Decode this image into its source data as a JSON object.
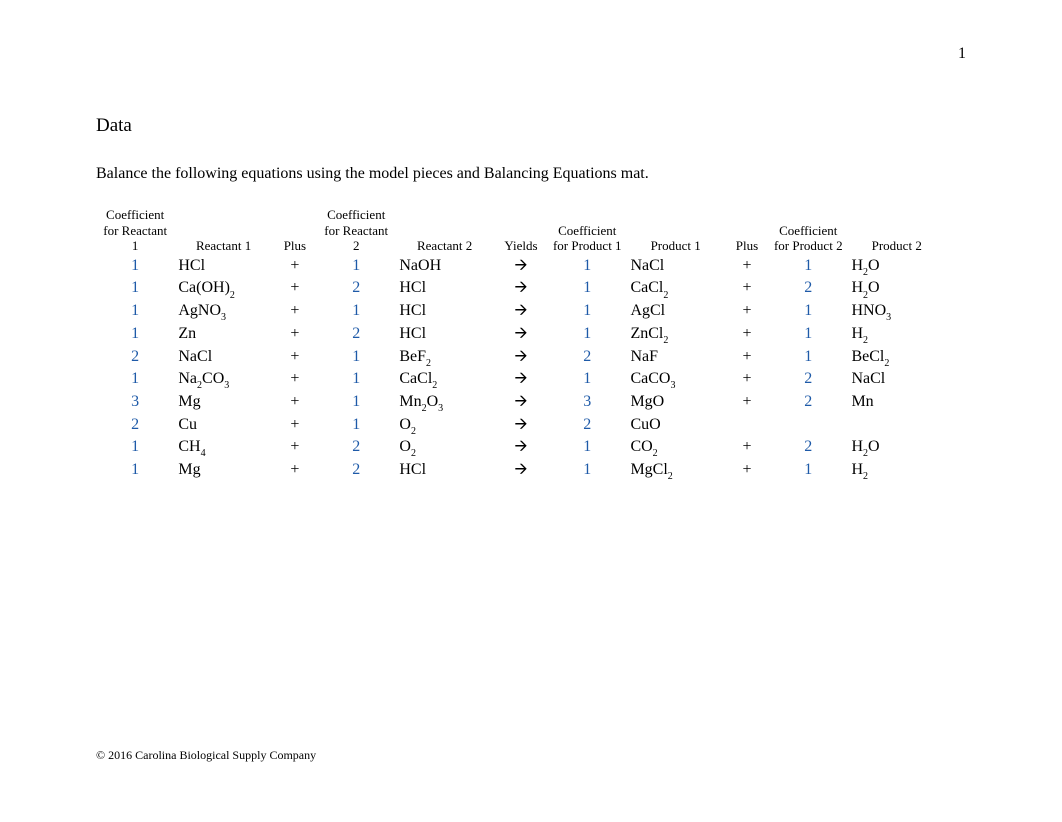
{
  "page_number": "1",
  "section_title": "Data",
  "instructions": "Balance the following equations using the model pieces and Balancing Equations mat.",
  "footer": "© 2016 Carolina Biological Supply Company",
  "headers": {
    "c1": "Coefficient for Reactant 1",
    "r1": "Reactant 1",
    "p1": "Plus",
    "c2": "Coefficient for Reactant 2",
    "r2": "Reactant 2",
    "y": "Yields",
    "cp1": "Coefficient for Product 1",
    "pr1": "Product 1",
    "p2": "Plus",
    "cp2": "Coefficient for Product 2",
    "pr2": "Product 2"
  },
  "chart_data": {
    "type": "table",
    "columns": [
      "Coefficient for Reactant 1",
      "Reactant 1",
      "Plus",
      "Coefficient for Reactant 2",
      "Reactant 2",
      "Yields",
      "Coefficient for Product 1",
      "Product 1",
      "Plus",
      "Coefficient for Product 2",
      "Product 2"
    ],
    "rows": [
      {
        "c1": "1",
        "r1": "HCl",
        "plus1": "+",
        "c2": "1",
        "r2": "NaOH",
        "yields": "🡪",
        "cp1": "1",
        "pr1": "NaCl",
        "plus2": "+",
        "cp2": "1",
        "pr2": "H₂O"
      },
      {
        "c1": "1",
        "r1": "Ca(OH)₂",
        "plus1": "+",
        "c2": "2",
        "r2": "HCl",
        "yields": "🡪",
        "cp1": "1",
        "pr1": "CaCl₂",
        "plus2": "+",
        "cp2": "2",
        "pr2": "H₂O"
      },
      {
        "c1": "1",
        "r1": "AgNO₃",
        "plus1": "+",
        "c2": "1",
        "r2": "HCl",
        "yields": "🡪",
        "cp1": "1",
        "pr1": "AgCl",
        "plus2": "+",
        "cp2": "1",
        "pr2": "HNO₃"
      },
      {
        "c1": "1",
        "r1": "Zn",
        "plus1": "+",
        "c2": "2",
        "r2": "HCl",
        "yields": "🡪",
        "cp1": "1",
        "pr1": "ZnCl₂",
        "plus2": "+",
        "cp2": "1",
        "pr2": "H₂"
      },
      {
        "c1": "2",
        "r1": "NaCl",
        "plus1": "+",
        "c2": "1",
        "r2": "BeF₂",
        "yields": "🡪",
        "cp1": "2",
        "pr1": "NaF",
        "plus2": "+",
        "cp2": "1",
        "pr2": "BeCl₂"
      },
      {
        "c1": "1",
        "r1": "Na₂CO₃",
        "plus1": "+",
        "c2": "1",
        "r2": "CaCl₂",
        "yields": "🡪",
        "cp1": "1",
        "pr1": "CaCO₃",
        "plus2": "+",
        "cp2": "2",
        "pr2": "NaCl"
      },
      {
        "c1": "3",
        "r1": "Mg",
        "plus1": "+",
        "c2": "1",
        "r2": "Mn₂O₃",
        "yields": "🡪",
        "cp1": "3",
        "pr1": "MgO",
        "plus2": "+",
        "cp2": "2",
        "pr2": "Mn"
      },
      {
        "c1": "2",
        "r1": "Cu",
        "plus1": "+",
        "c2": "1",
        "r2": "O₂",
        "yields": "🡪",
        "cp1": "2",
        "pr1": "CuO",
        "plus2": "",
        "cp2": "",
        "pr2": ""
      },
      {
        "c1": "1",
        "r1": "CH₄",
        "plus1": "+",
        "c2": "2",
        "r2": "O₂",
        "yields": "🡪",
        "cp1": "1",
        "pr1": "CO₂",
        "plus2": "+",
        "cp2": "2",
        "pr2": "H₂O"
      },
      {
        "c1": "1",
        "r1": "Mg",
        "plus1": "+",
        "c2": "2",
        "r2": "HCl",
        "yields": "🡪",
        "cp1": "1",
        "pr1": "MgCl₂",
        "plus2": "+",
        "cp2": "1",
        "pr2": "H₂"
      }
    ]
  }
}
